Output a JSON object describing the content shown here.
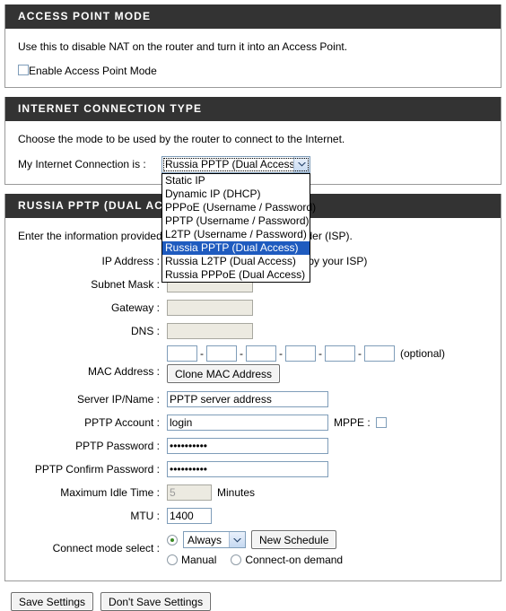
{
  "access_point": {
    "header": "ACCESS POINT MODE",
    "intro": "Use this to disable NAT on the router and turn it into an Access Point.",
    "checkbox_label": "Enable Access Point Mode",
    "checkbox_checked": false
  },
  "connection_type": {
    "header": "INTERNET CONNECTION TYPE",
    "intro": "Choose the mode to be used by the router to connect to the Internet.",
    "select_label": "My Internet Connection is :",
    "selected": "Russia PPTP (Dual Access)",
    "open": true,
    "options": [
      "Static IP",
      "Dynamic IP (DHCP)",
      "PPPoE (Username / Password)",
      "PPTP (Username / Password)",
      "L2TP (Username / Password)",
      "Russia PPTP (Dual Access)",
      "Russia L2TP (Dual Access)",
      "Russia PPPoE (Dual Access)"
    ],
    "highlight_color": "#1f5bbf"
  },
  "russia_pptp": {
    "header": "RUSSIA PPTP (DUAL ACCESS)",
    "intro": "Enter the information provided by your Internet Service Provider (ISP).",
    "fields": {
      "ip_address": {
        "label": "IP Address :",
        "value": "",
        "disabled": true,
        "hint": "(assigned by your ISP)"
      },
      "subnet_mask": {
        "label": "Subnet Mask :",
        "value": "",
        "disabled": true
      },
      "gateway": {
        "label": "Gateway :",
        "value": "",
        "disabled": true
      },
      "dns": {
        "label": "DNS :",
        "value": "",
        "disabled": true
      },
      "mac_address": {
        "label": "MAC Address :",
        "octets": [
          "",
          "",
          "",
          "",
          "",
          ""
        ],
        "separator": "-",
        "hint": "(optional)",
        "clone_button": "Clone MAC Address"
      },
      "server_ip_name": {
        "label": "Server IP/Name :",
        "value": "PPTP server address"
      },
      "pptp_account": {
        "label": "PPTP Account :",
        "value": "login"
      },
      "mppe": {
        "label": "MPPE :",
        "checked": false
      },
      "pptp_password": {
        "label": "PPTP Password :",
        "value": "••••••••••"
      },
      "pptp_confirm_password": {
        "label": "PPTP Confirm Password :",
        "value": "••••••••••"
      },
      "maximum_idle_time": {
        "label": "Maximum Idle Time :",
        "value": "5",
        "disabled": true,
        "unit": "Minutes"
      },
      "mtu": {
        "label": "MTU :",
        "value": "1400"
      },
      "connect_mode": {
        "label": "Connect mode select :",
        "schedule_selected": "Always",
        "schedule_options": [
          "Always"
        ],
        "new_schedule_button": "New Schedule",
        "option_always_selected": true,
        "option_manual": "Manual",
        "option_manual_selected": false,
        "option_on_demand": "Connect-on demand",
        "option_on_demand_selected": false
      }
    }
  },
  "footer": {
    "save_label": "Save Settings",
    "dont_save_label": "Don't Save Settings"
  }
}
